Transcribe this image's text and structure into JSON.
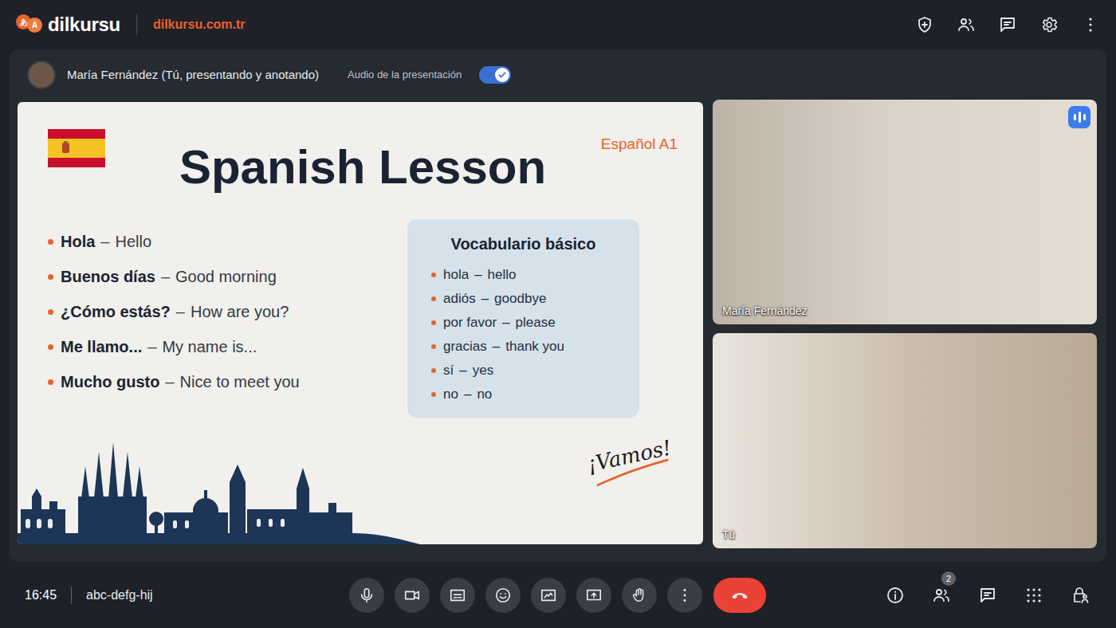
{
  "header": {
    "logo_glyphs": [
      "あ",
      "A"
    ],
    "brand": "dilkursu",
    "url": "dilkursu.com.tr"
  },
  "presenter_bar": {
    "name": "María Fernández (Tú, presentando y anotando)",
    "audio_label": "Audio de la presentación",
    "audio_on": true
  },
  "slide": {
    "title": "Spanish Lesson",
    "level_tag": "Español A1",
    "separator": "–",
    "phrases": [
      {
        "term": "Hola",
        "meaning": "Hello"
      },
      {
        "term": "Buenos días",
        "meaning": "Good morning"
      },
      {
        "term": "¿Cómo estás?",
        "meaning": "How are you?"
      },
      {
        "term": "Me llamo...",
        "meaning": "My name is..."
      },
      {
        "term": "Mucho gusto",
        "meaning": "Nice to meet you"
      }
    ],
    "vocab_title": "Vocabulario básico",
    "vocab": [
      {
        "word": "hola",
        "meaning": "hello"
      },
      {
        "word": "adiós",
        "meaning": "goodbye"
      },
      {
        "word": "por favor",
        "meaning": "please"
      },
      {
        "word": "gracias",
        "meaning": "thank you"
      },
      {
        "word": "sí",
        "meaning": "yes"
      },
      {
        "word": "no",
        "meaning": "no"
      }
    ],
    "signature": "¡Vamos!"
  },
  "participants": [
    {
      "name": "María Fernández",
      "speaking": true
    },
    {
      "name": "Tú",
      "speaking": false
    }
  ],
  "footer": {
    "time": "16:45",
    "meeting_code": "abc-defg-hij",
    "people_count": "2"
  }
}
